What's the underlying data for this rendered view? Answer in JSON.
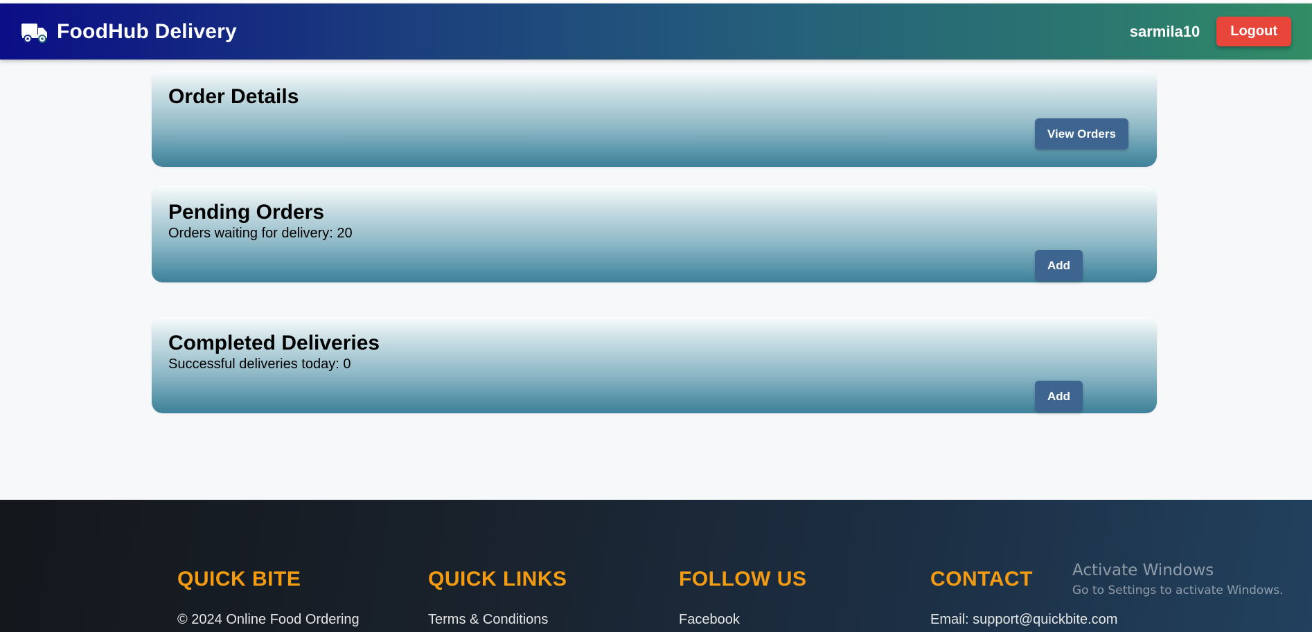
{
  "header": {
    "brand_icon": "delivery-truck-icon",
    "brand_title": "FoodHub Delivery",
    "username": "sarmila10",
    "logout_label": "Logout"
  },
  "cards": {
    "order_details": {
      "title": "Order Details",
      "button_label": "View Orders"
    },
    "pending_orders": {
      "title": "Pending Orders",
      "subtitle": "Orders waiting for delivery: 20",
      "button_label": "Add"
    },
    "completed_deliveries": {
      "title": "Completed Deliveries",
      "subtitle": "Successful deliveries today: 0",
      "button_label": "Add"
    }
  },
  "footer": {
    "quick_bite": {
      "heading": "QUICK BITE",
      "text": "© 2024 Online Food Ordering"
    },
    "quick_links": {
      "heading": "QUICK LINKS",
      "first_link": "Terms & Conditions"
    },
    "follow_us": {
      "heading": "FOLLOW US",
      "first_link": "Facebook"
    },
    "contact": {
      "heading": "CONTACT",
      "email": "Email: support@quickbite.com"
    }
  },
  "watermark": {
    "title": "Activate Windows",
    "subtitle": "Go to Settings to activate Windows."
  },
  "colors": {
    "navbar_start": "#0b0e86",
    "navbar_end": "#318d66",
    "logout": "#e8463b",
    "card_button": "#3d6590",
    "footer_heading": "#f39c12",
    "footer_bg": "#19212b"
  }
}
